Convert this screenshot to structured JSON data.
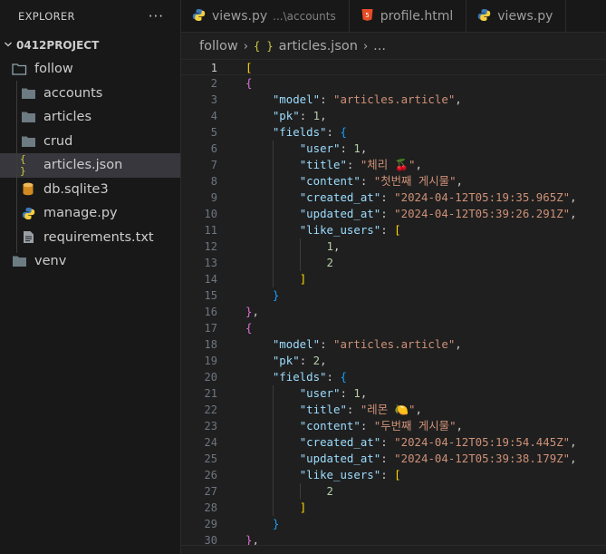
{
  "explorer": {
    "title": "EXPLORER",
    "more_label": "···",
    "project": "0412PROJECT",
    "items": [
      {
        "label": "follow",
        "type": "folder-open",
        "level": 1
      },
      {
        "label": "accounts",
        "type": "folder",
        "level": 2
      },
      {
        "label": "articles",
        "type": "folder",
        "level": 2
      },
      {
        "label": "crud",
        "type": "folder",
        "level": 2
      },
      {
        "label": "articles.json",
        "type": "json",
        "level": 2,
        "selected": true
      },
      {
        "label": "db.sqlite3",
        "type": "database",
        "level": 2
      },
      {
        "label": "manage.py",
        "type": "python",
        "level": 2
      },
      {
        "label": "requirements.txt",
        "type": "text",
        "level": 2
      },
      {
        "label": "venv",
        "type": "folder",
        "level": 1
      }
    ]
  },
  "tabs": [
    {
      "label": "views.py",
      "description": "...\\accounts",
      "icon": "python-icon"
    },
    {
      "label": "profile.html",
      "description": "",
      "icon": "html-icon"
    },
    {
      "label": "views.py",
      "description": "",
      "icon": "python-icon"
    }
  ],
  "breadcrumb": {
    "folder": "follow",
    "json_icon": "{ }",
    "file": "articles.json",
    "more": "..."
  },
  "editor": {
    "current_line": 1,
    "lines": [
      "[",
      "{",
      "    \"model\": \"articles.article\",",
      "    \"pk\": 1,",
      "    \"fields\": {",
      "        \"user\": 1,",
      "        \"title\": \"체리 🍒\",",
      "        \"content\": \"첫번째 게시물\",",
      "        \"created_at\": \"2024-04-12T05:19:35.965Z\",",
      "        \"updated_at\": \"2024-04-12T05:39:26.291Z\",",
      "        \"like_users\": [",
      "            1,",
      "            2",
      "        ]",
      "    }",
      "},",
      "{",
      "    \"model\": \"articles.article\",",
      "    \"pk\": 2,",
      "    \"fields\": {",
      "        \"user\": 1,",
      "        \"title\": \"레몬 🍋\",",
      "        \"content\": \"두번째 게시물\",",
      "        \"created_at\": \"2024-04-12T05:19:54.445Z\",",
      "        \"updated_at\": \"2024-04-12T05:39:38.179Z\",",
      "        \"like_users\": [",
      "            2",
      "        ]",
      "    }",
      "},"
    ]
  },
  "colors": {
    "key": "#9cdcfe",
    "string": "#ce9178",
    "number": "#b5cea8",
    "bracket1": "#ffd700",
    "bracket2": "#da70d6",
    "bracket3": "#179fff"
  }
}
